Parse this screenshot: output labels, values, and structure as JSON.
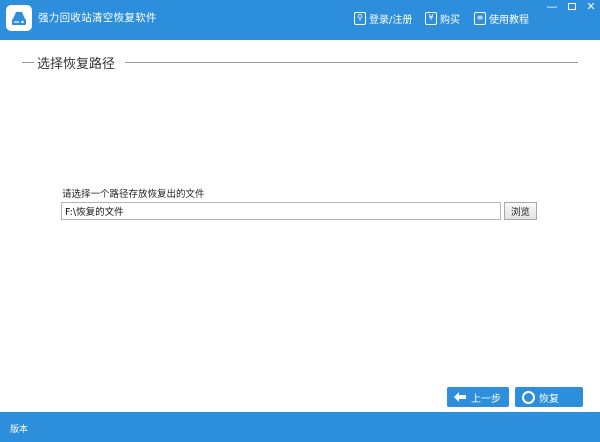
{
  "app": {
    "title": "强力回收站清空恢复软件",
    "logo_icon": "recycle-drive-icon",
    "accent_color": "#2d8fdb"
  },
  "top_links": {
    "login": "登录/注册",
    "buy": "购买",
    "tutorial": "使用教程"
  },
  "window_controls": {
    "minimize": "—",
    "close": "✕"
  },
  "section": {
    "title": "选择恢复路径"
  },
  "path": {
    "prompt": "请选择一个路径存放恢复出的文件",
    "value": "F:\\恢复的文件",
    "browse_label": "浏览"
  },
  "nav": {
    "prev_label": "上一步",
    "next_label": "恢复"
  },
  "status": {
    "version_label": "版本"
  }
}
